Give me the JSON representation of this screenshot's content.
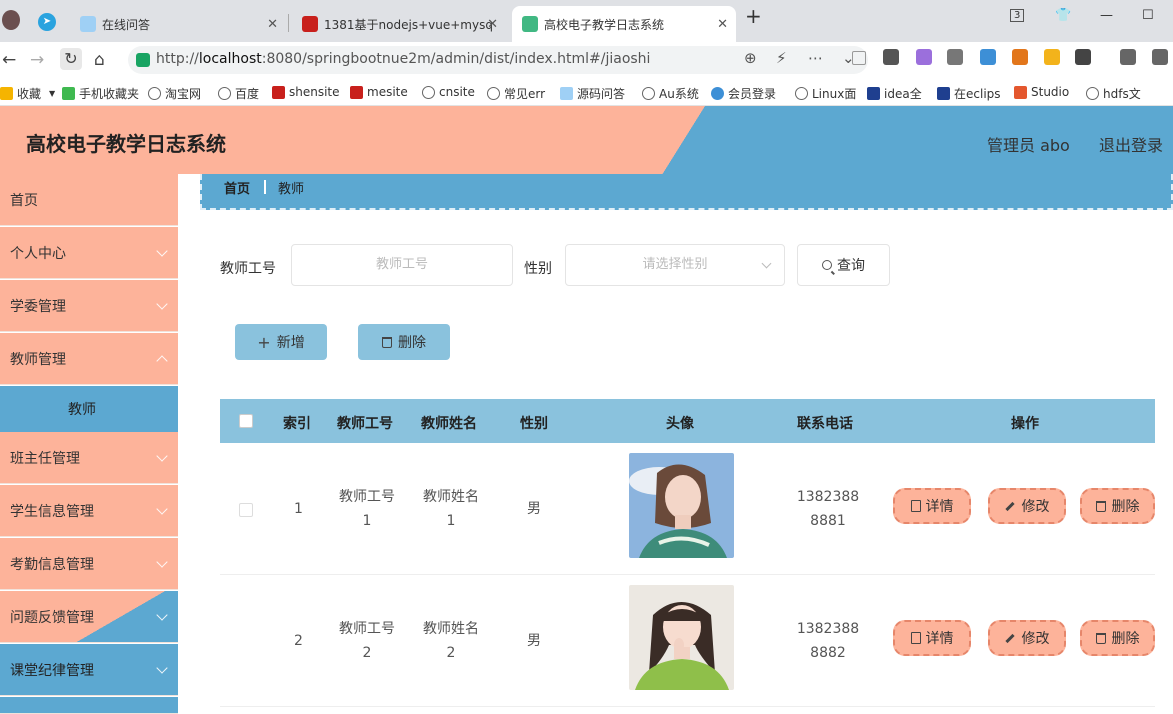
{
  "browser": {
    "tabs": [
      {
        "label": "在线问答"
      },
      {
        "label": "1381基于nodejs+vue+mysq"
      },
      {
        "label": "高校电子教学日志系统"
      }
    ],
    "tab_count": "3",
    "url_prefix": "http://",
    "url_host": "localhost",
    "url_rest": ":8080/springbootnue2m/admin/dist/index.html#/jiaoshi",
    "bookmarks": [
      "收藏",
      "手机收藏夹",
      "淘宝网",
      "百度",
      "shensite",
      "mesite",
      "cnsite",
      "常见err",
      "源码问答",
      "Au系统",
      "会员登录",
      "Linux面",
      "idea全",
      "在eclips",
      "Studio",
      "hdfs文"
    ]
  },
  "header": {
    "title": "高校电子教学日志系统",
    "user": "管理员 abo",
    "logout": "退出登录"
  },
  "sidebar": {
    "items": [
      {
        "label": "首页"
      },
      {
        "label": "个人中心"
      },
      {
        "label": "学委管理"
      },
      {
        "label": "教师管理"
      },
      {
        "label": "班主任管理"
      },
      {
        "label": "学生信息管理"
      },
      {
        "label": "考勤信息管理"
      },
      {
        "label": "问题反馈管理"
      },
      {
        "label": "课堂纪律管理"
      }
    ],
    "submenu_active": "教师"
  },
  "breadcrumb": {
    "home": "首页",
    "current": "教师"
  },
  "search": {
    "teacher_no_label": "教师工号",
    "teacher_no_placeholder": "教师工号",
    "gender_label": "性别",
    "gender_placeholder": "请选择性别",
    "query_button": "查询"
  },
  "actions": {
    "add": "新增",
    "delete": "删除"
  },
  "table": {
    "columns": [
      "索引",
      "教师工号",
      "教师姓名",
      "性别",
      "头像",
      "联系电话",
      "操作"
    ],
    "rows": [
      {
        "index": "1",
        "no_a": "教师工号",
        "no_b": "1",
        "name_a": "教师姓名",
        "name_b": "1",
        "gender": "男",
        "phone_a": "1382388",
        "phone_b": "8881"
      },
      {
        "index": "2",
        "no_a": "教师工号",
        "no_b": "2",
        "name_a": "教师姓名",
        "name_b": "2",
        "gender": "男",
        "phone_a": "1382388",
        "phone_b": "8882"
      }
    ],
    "ops": {
      "detail": "详情",
      "edit": "修改",
      "delete": "删除"
    }
  }
}
